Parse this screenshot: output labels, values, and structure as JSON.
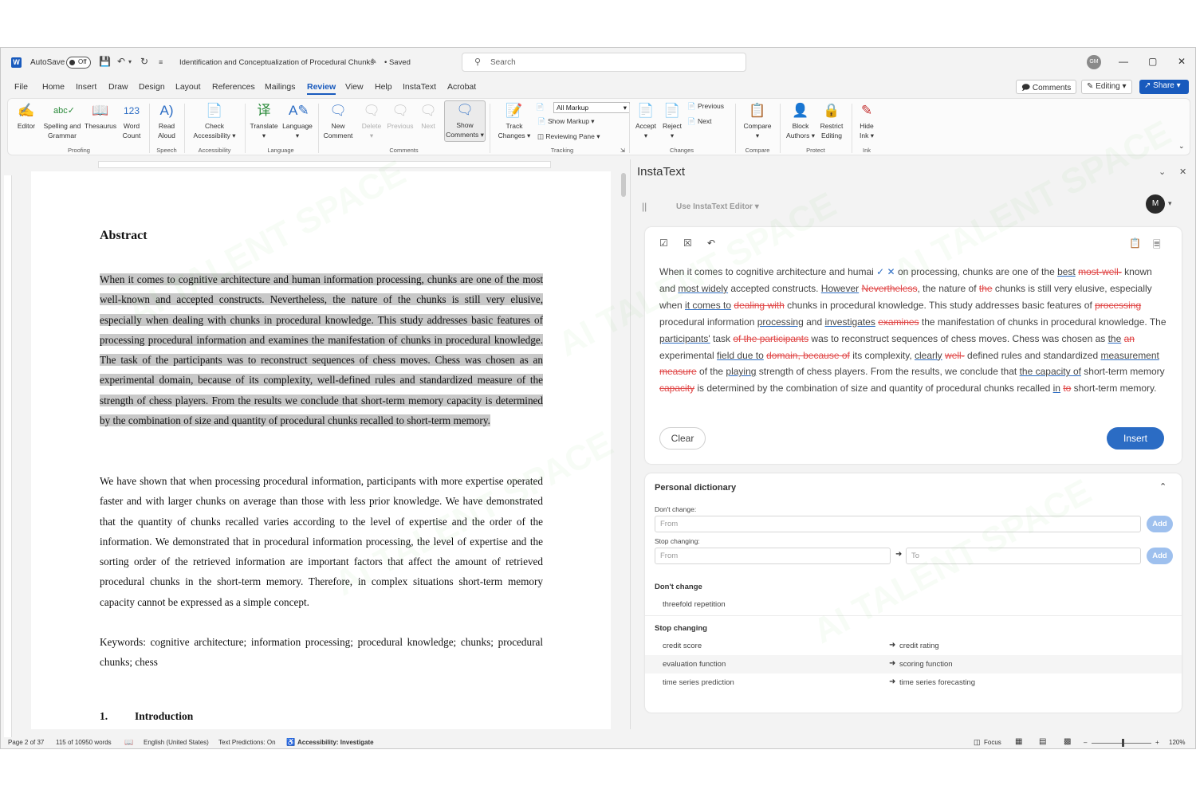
{
  "titlebar": {
    "app_icon": "word-logo",
    "autosave_label": "AutoSave",
    "autosave_state": "Off",
    "document_title": "Identification and Conceptualization of Procedural Chunks",
    "saved_status": "• Saved",
    "search_placeholder": "Search",
    "user_initials": "GM"
  },
  "menu": {
    "tabs": [
      "File",
      "Home",
      "Insert",
      "Draw",
      "Design",
      "Layout",
      "References",
      "Mailings",
      "Review",
      "View",
      "Help",
      "InstaText",
      "Acrobat"
    ],
    "active_tab": "Review",
    "comments_label": "Comments",
    "editing_label": "Editing",
    "share_label": "Share"
  },
  "ribbon": {
    "editor": "Editor",
    "spelling": "Spelling and Grammar",
    "thesaurus": "Thesaurus",
    "word_count": "Word Count",
    "read_aloud": "Read Aloud",
    "check_accessibility": "Check Accessibility",
    "translate": "Translate",
    "language": "Language",
    "new_comment": "New Comment",
    "delete": "Delete",
    "previous": "Previous",
    "next": "Next",
    "show_comments": "Show Comments",
    "track_changes": "Track Changes",
    "all_markup": "All Markup",
    "show_markup": "Show Markup",
    "reviewing_pane": "Reviewing Pane",
    "accept": "Accept",
    "reject": "Reject",
    "prev_change": "Previous",
    "next_change": "Next",
    "compare": "Compare",
    "block_authors": "Block Authors",
    "restrict_editing": "Restrict Editing",
    "hide_ink": "Hide Ink",
    "groups": {
      "proofing": "Proofing",
      "speech": "Speech",
      "accessibility": "Accessibility",
      "language": "Language",
      "comments": "Comments",
      "tracking": "Tracking",
      "changes": "Changes",
      "compare": "Compare",
      "protect": "Protect",
      "ink": "Ink"
    }
  },
  "document": {
    "heading": "Abstract",
    "abstract": "When it comes to cognitive architecture and human information processing, chunks are one of the most well-known and accepted constructs. Nevertheless, the nature of the chunks is still very elusive, especially when dealing with chunks in procedural knowledge. This study addresses basic features of processing procedural information and examines the manifestation of chunks in procedural knowledge. The task of the participants was to reconstruct sequences of chess moves. Chess was chosen as an experimental domain, because of its complexity, well-defined rules and standardized measure of the strength of chess players. From the results we conclude that short-term memory capacity is determined by the combination of size and quantity of procedural chunks recalled to short-term memory.",
    "paragraph2": "We have shown that when processing procedural information, participants with more expertise operated faster and with larger chunks on average than those with less prior knowledge. We have demonstrated that the quantity of chunks recalled varies according to the level of expertise and the order of the information. We demonstrated that in procedural information processing, the level of expertise and the sorting order of the retrieved information are important factors that affect the amount of retrieved procedural chunks in the short-term memory. Therefore, in complex situations short-term memory capacity cannot be expressed as a simple concept.",
    "keywords": "Keywords: cognitive architecture; information processing; procedural knowledge; chunks; procedural chunks; chess",
    "section_number": "1.",
    "section_title": "Introduction"
  },
  "instatext": {
    "panel_title": "InstaText",
    "editor_select": "Use InstaText Editor",
    "avatar_initial": "M",
    "suggestion": [
      {
        "t": "When it comes to cognitive architecture and humai ",
        "k": "n"
      },
      {
        "t": "✓",
        "k": "ok"
      },
      {
        "t": "  ",
        "k": "n"
      },
      {
        "t": "✕",
        "k": "ok"
      },
      {
        "t": "  on processing, chunks are one of the ",
        "k": "n"
      },
      {
        "t": "best",
        "k": "i"
      },
      {
        "t": " ",
        "k": "n"
      },
      {
        "t": "most-well-",
        "k": "d"
      },
      {
        "t": " known and ",
        "k": "n"
      },
      {
        "t": "most widely",
        "k": "i"
      },
      {
        "t": " accepted constructs. ",
        "k": "n"
      },
      {
        "t": "However",
        "k": "i"
      },
      {
        "t": " ",
        "k": "n"
      },
      {
        "t": "Nevertheless",
        "k": "d"
      },
      {
        "t": ", the nature of ",
        "k": "n"
      },
      {
        "t": "the",
        "k": "d"
      },
      {
        "t": " chunks is still very elusive, especially when ",
        "k": "n"
      },
      {
        "t": "it comes to",
        "k": "i"
      },
      {
        "t": " ",
        "k": "n"
      },
      {
        "t": "dealing with",
        "k": "d"
      },
      {
        "t": " chunks in procedural knowledge. This study addresses basic features of ",
        "k": "n"
      },
      {
        "t": "processing",
        "k": "d"
      },
      {
        "t": " procedural information ",
        "k": "n"
      },
      {
        "t": "processing",
        "k": "i"
      },
      {
        "t": " and ",
        "k": "n"
      },
      {
        "t": "investigates",
        "k": "i"
      },
      {
        "t": " ",
        "k": "n"
      },
      {
        "t": "examines",
        "k": "d"
      },
      {
        "t": " the manifestation of chunks in procedural knowledge. The ",
        "k": "n"
      },
      {
        "t": "participants'",
        "k": "i"
      },
      {
        "t": " task ",
        "k": "n"
      },
      {
        "t": "of the participants",
        "k": "d"
      },
      {
        "t": " was to reconstruct sequences of chess moves. Chess was chosen as ",
        "k": "n"
      },
      {
        "t": "the",
        "k": "i"
      },
      {
        "t": " ",
        "k": "n"
      },
      {
        "t": "an",
        "k": "d"
      },
      {
        "t": " experimental ",
        "k": "n"
      },
      {
        "t": "field due to",
        "k": "i"
      },
      {
        "t": " ",
        "k": "n"
      },
      {
        "t": "domain, because of",
        "k": "d"
      },
      {
        "t": " its complexity, ",
        "k": "n"
      },
      {
        "t": "clearly",
        "k": "i"
      },
      {
        "t": " ",
        "k": "n"
      },
      {
        "t": "well-",
        "k": "d"
      },
      {
        "t": " defined rules and standardized ",
        "k": "n"
      },
      {
        "t": "measurement",
        "k": "i"
      },
      {
        "t": " ",
        "k": "n"
      },
      {
        "t": "measure",
        "k": "d"
      },
      {
        "t": " of the ",
        "k": "n"
      },
      {
        "t": "playing",
        "k": "i"
      },
      {
        "t": " strength of chess players. From the results, we conclude that ",
        "k": "n"
      },
      {
        "t": "the capacity of",
        "k": "i"
      },
      {
        "t": " short-term memory ",
        "k": "n"
      },
      {
        "t": "capacity",
        "k": "d"
      },
      {
        "t": " is determined by the combination of size and quantity of procedural chunks recalled ",
        "k": "n"
      },
      {
        "t": "in",
        "k": "i"
      },
      {
        "t": " ",
        "k": "n"
      },
      {
        "t": "to",
        "k": "d"
      },
      {
        "t": " short-term memory.",
        "k": "n"
      }
    ],
    "clear_label": "Clear",
    "insert_label": "Insert",
    "dictionary": {
      "title": "Personal dictionary",
      "dont_change_label": "Don't change:",
      "stop_changing_label": "Stop changing:",
      "from_placeholder": "From",
      "to_placeholder": "To",
      "add_label": "Add",
      "dont_change_heading": "Don't change",
      "dont_change_items": [
        "threefold repetition"
      ],
      "stop_changing_heading": "Stop changing",
      "stop_changing_items": [
        {
          "from": "credit score",
          "to": "credit rating"
        },
        {
          "from": "evaluation function",
          "to": "scoring function"
        },
        {
          "from": "time series prediction",
          "to": "time series forecasting"
        }
      ]
    }
  },
  "statusbar": {
    "page": "Page 2 of 37",
    "words": "115 of 10950 words",
    "language": "English (United States)",
    "text_predictions": "Text Predictions: On",
    "accessibility": "Accessibility: Investigate",
    "focus": "Focus",
    "zoom": "120%"
  },
  "watermark": "AI TALENT SPACE",
  "colors": {
    "accent": "#185abd",
    "insert_button": "#2b6cc4",
    "deletion": "#e04848",
    "selection_highlight": "#c8c8c8"
  }
}
